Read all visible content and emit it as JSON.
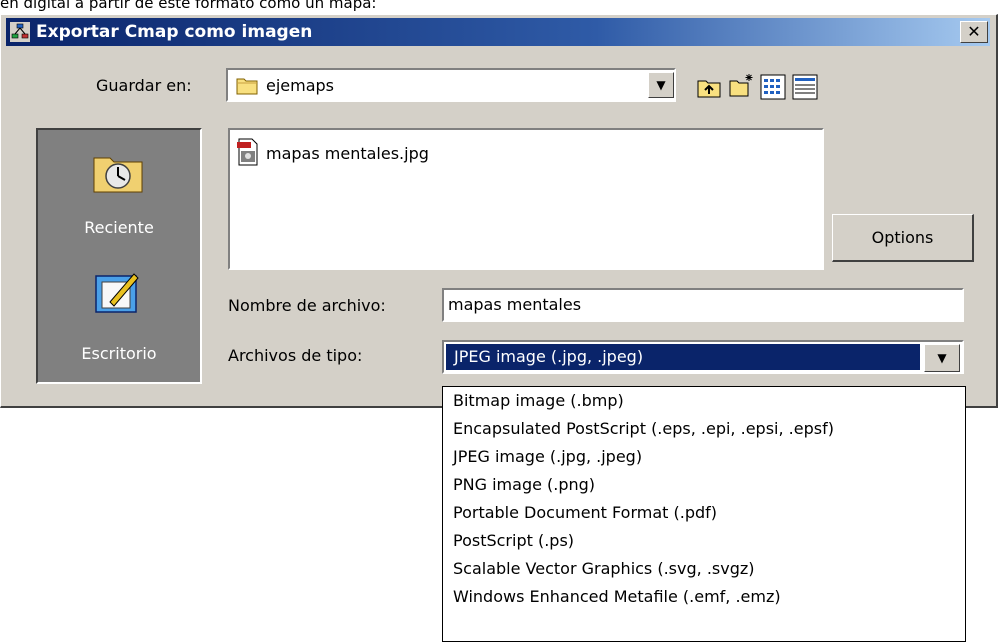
{
  "caption": "en digital a partir de este formato como un mapa:",
  "dialog": {
    "title": "Exportar Cmap como imagen",
    "close_glyph": "✕"
  },
  "save_in": {
    "label": "Guardar en:",
    "value": "ejemaps",
    "arrow_glyph": "▼"
  },
  "toolbar_icons": [
    "up-folder-icon",
    "new-folder-icon",
    "list-view-icon",
    "details-view-icon"
  ],
  "places": [
    {
      "label": "Reciente",
      "icon": "recent-clock-folder-icon"
    },
    {
      "label": "Escritorio",
      "icon": "desktop-notepad-icon"
    }
  ],
  "files": [
    {
      "name": "mapas mentales.jpg",
      "icon": "jpg-file-icon"
    }
  ],
  "options_button": "Options",
  "filename": {
    "label": "Nombre de archivo:",
    "value": "mapas mentales"
  },
  "filetype": {
    "label": "Archivos de tipo:",
    "selected": "JPEG image (.jpg, .jpeg)",
    "arrow_glyph": "▼",
    "options": [
      "Bitmap image (.bmp)",
      "Encapsulated PostScript (.eps, .epi, .epsi, .epsf)",
      "JPEG image (.jpg, .jpeg)",
      "PNG image (.png)",
      "Portable Document Format (.pdf)",
      "PostScript (.ps)",
      "Scalable Vector Graphics (.svg, .svgz)",
      "Windows Enhanced Metafile (.emf, .emz)"
    ]
  },
  "colors": {
    "titlebar": "#0a246a",
    "dialog_face": "#d4d0c8",
    "selection": "#0a246a",
    "places_bg": "#808080"
  }
}
